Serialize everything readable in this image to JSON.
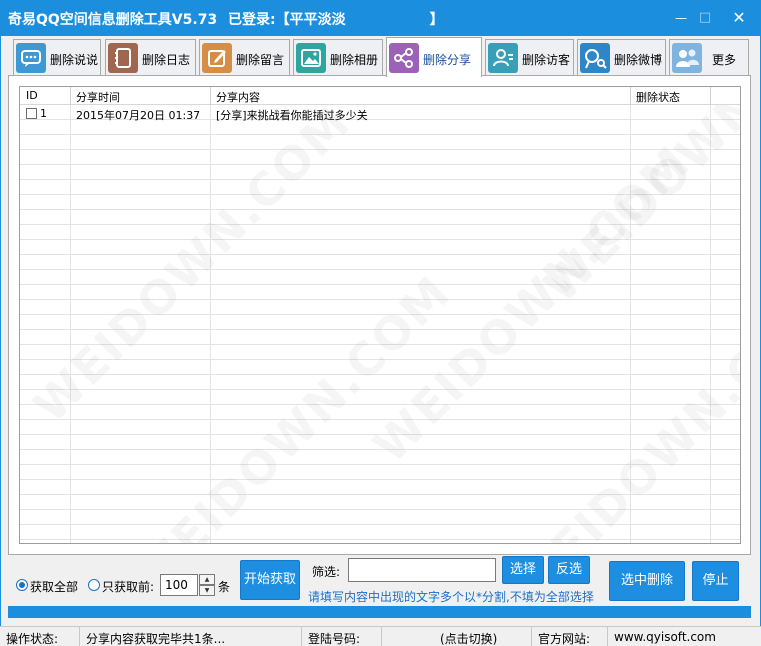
{
  "window": {
    "title": "奇易QQ空间信息删除工具V5.73",
    "login_text": "已登录:【平平淡淡　　　　　　】",
    "minimize": "—",
    "maximize": "□",
    "close": "✕"
  },
  "tabs": [
    {
      "label": "删除说说",
      "icon": "chat-bubble-icon",
      "color": "#3e98d6"
    },
    {
      "label": "删除日志",
      "icon": "notebook-icon",
      "color": "#a0664f"
    },
    {
      "label": "删除留言",
      "icon": "edit-note-icon",
      "color": "#d68d45"
    },
    {
      "label": "删除相册",
      "icon": "photo-album-icon",
      "color": "#2ea6a0"
    },
    {
      "label": "删除分享",
      "icon": "share-icon",
      "color": "#9b62b8",
      "active": true
    },
    {
      "label": "删除访客",
      "icon": "visitor-icon",
      "color": "#37a0b8"
    },
    {
      "label": "删除微博",
      "icon": "weibo-icon",
      "color": "#2e86c7"
    },
    {
      "label": "更多",
      "icon": "users-icon",
      "color": "#7fb3e0"
    }
  ],
  "table": {
    "columns": [
      "ID",
      "分享时间",
      "分享内容",
      "删除状态"
    ],
    "rows": [
      {
        "id": "1",
        "time": "2015年07月20日 01:37",
        "content": "[分享]来挑战看你能插过多少关",
        "status": ""
      }
    ]
  },
  "watermark": "WEIDOWN.COM",
  "controls": {
    "radio_all": "获取全部",
    "radio_first": "只获取前:",
    "count_value": "100",
    "count_unit": "条",
    "start_button": "开始获取",
    "filter_label": "筛选:",
    "filter_value": "",
    "select_button": "选择",
    "invert_button": "反选",
    "delete_button": "选中删除",
    "stop_button": "停止",
    "hint": "请填写内容中出现的文字多个以*分割,不填为全部选择"
  },
  "statusbar": {
    "op_label": "操作状态:",
    "op_value": "分享内容获取完毕共1条...",
    "login_label": "登陆号码:",
    "switch_hint": "(点击切换)",
    "site_label": "官方网站:",
    "site_value": "www.qyisoft.com"
  },
  "colors": {
    "titlebar": "#1b8fde",
    "button": "#1e8fe0",
    "hint_text": "#1b6fc7"
  }
}
